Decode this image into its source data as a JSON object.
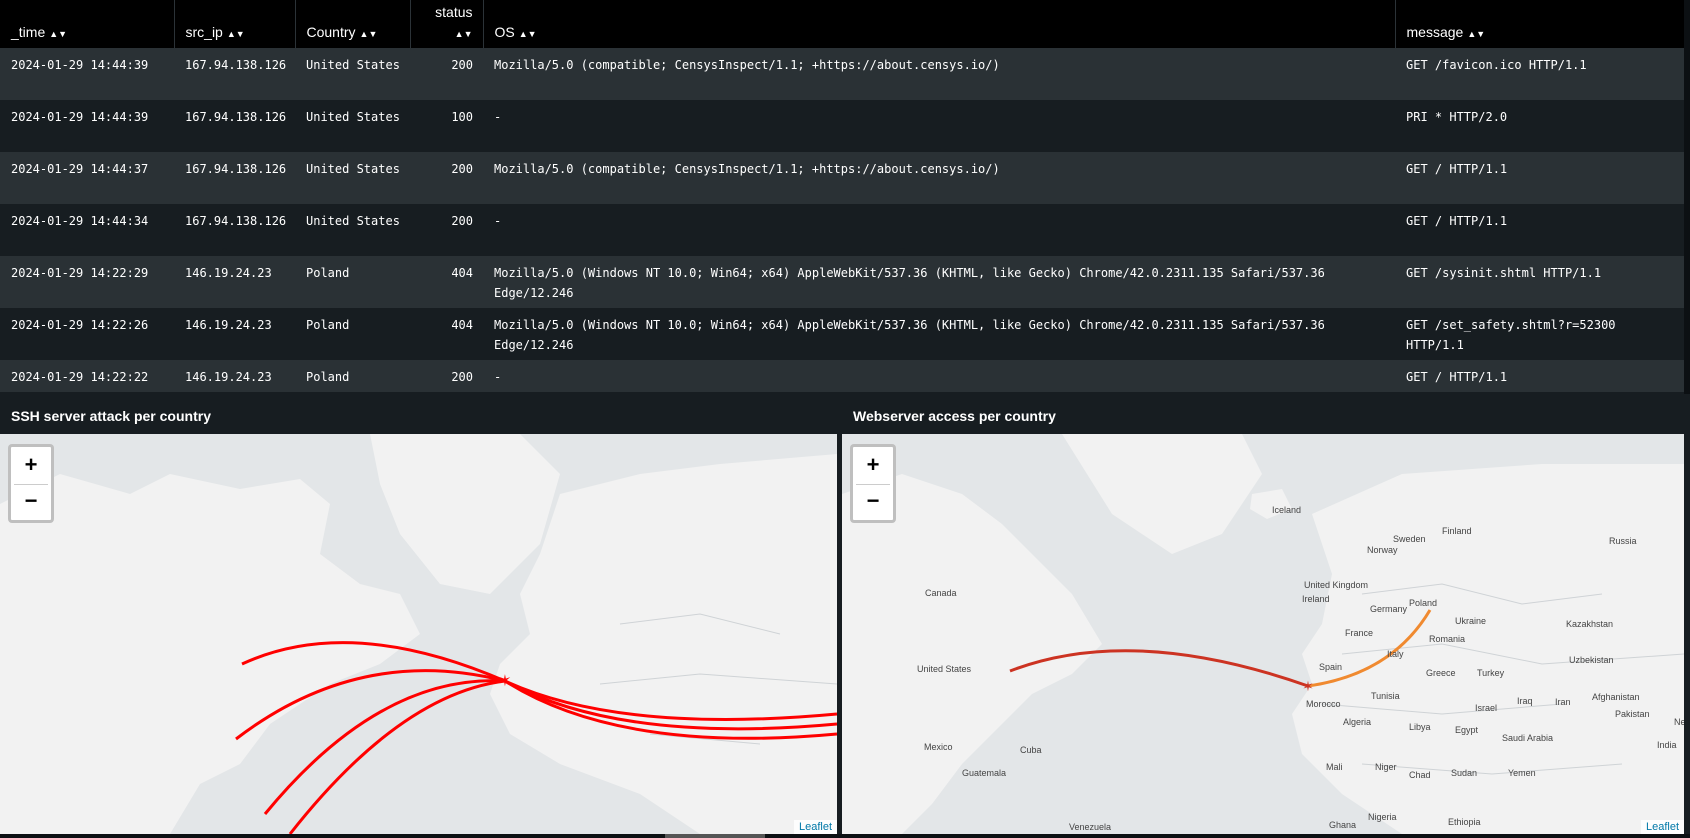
{
  "table": {
    "columns": [
      {
        "label": "_time",
        "sortable": true
      },
      {
        "label": "src_ip",
        "sortable": true
      },
      {
        "label": "Country",
        "sortable": true
      },
      {
        "label": "status",
        "sortable": true
      },
      {
        "label": "OS",
        "sortable": true
      },
      {
        "label": "message",
        "sortable": true
      }
    ],
    "rows": [
      {
        "time": "2024-01-29 14:44:39",
        "src_ip": "167.94.138.126",
        "country": "United States",
        "status": "200",
        "os": "Mozilla/5.0 (compatible; CensysInspect/1.1; +https://about.censys.io/)",
        "message": "GET /favicon.ico HTTP/1.1"
      },
      {
        "time": "2024-01-29 14:44:39",
        "src_ip": "167.94.138.126",
        "country": "United States",
        "status": "100",
        "os": "-",
        "message": "PRI * HTTP/2.0"
      },
      {
        "time": "2024-01-29 14:44:37",
        "src_ip": "167.94.138.126",
        "country": "United States",
        "status": "200",
        "os": "Mozilla/5.0 (compatible; CensysInspect/1.1; +https://about.censys.io/)",
        "message": "GET / HTTP/1.1"
      },
      {
        "time": "2024-01-29 14:44:34",
        "src_ip": "167.94.138.126",
        "country": "United States",
        "status": "200",
        "os": "-",
        "message": "GET / HTTP/1.1"
      },
      {
        "time": "2024-01-29 14:22:29",
        "src_ip": "146.19.24.23",
        "country": "Poland",
        "status": "404",
        "os": "Mozilla/5.0 (Windows NT 10.0; Win64; x64) AppleWebKit/537.36 (KHTML, like Gecko) Chrome/42.0.2311.135 Safari/537.36 Edge/12.246",
        "message": "GET /sysinit.shtml HTTP/1.1"
      },
      {
        "time": "2024-01-29 14:22:26",
        "src_ip": "146.19.24.23",
        "country": "Poland",
        "status": "404",
        "os": "Mozilla/5.0 (Windows NT 10.0; Win64; x64) AppleWebKit/537.36 (KHTML, like Gecko) Chrome/42.0.2311.135 Safari/537.36 Edge/12.246",
        "message": "GET /set_safety.shtml?r=52300 HTTP/1.1"
      },
      {
        "time": "2024-01-29 14:22:22",
        "src_ip": "146.19.24.23",
        "country": "Poland",
        "status": "200",
        "os": "-",
        "message": "GET / HTTP/1.1"
      }
    ]
  },
  "panels": {
    "ssh": {
      "title": "SSH server attack per country",
      "zoom_in": "+",
      "zoom_out": "−",
      "attribution": "Leaflet"
    },
    "web": {
      "title": "Webserver access per country",
      "zoom_in": "+",
      "zoom_out": "−",
      "attribution": "Leaflet",
      "labels": [
        "Iceland",
        "Finland",
        "Sweden",
        "Norway",
        "Russia",
        "Canada",
        "United Kingdom",
        "Ireland",
        "Germany",
        "Poland",
        "Ukraine",
        "Kazakhstan",
        "France",
        "Romania",
        "United States",
        "Italy",
        "Uzbekistan",
        "Spain",
        "Greece",
        "Turkey",
        "Tunisia",
        "Iraq",
        "Iran",
        "Afghanistan",
        "Morocco",
        "Israel",
        "Pakistan",
        "Ne",
        "Algeria",
        "Libya",
        "Egypt",
        "Saudi Arabia",
        "Mexico",
        "Cuba",
        "India",
        "Guatemala",
        "Mali",
        "Niger",
        "Chad",
        "Sudan",
        "Yemen",
        "Venezuela",
        "Ghana",
        "Nigeria",
        "Ethiopia"
      ]
    }
  },
  "colors": {
    "ssh_arc": "#ff0000",
    "web_arc_us": "#cc3322",
    "web_arc_pl": "#f08a30",
    "header_bg": "#000000",
    "row_odd": "#2a3135",
    "row_even": "#171d21"
  }
}
